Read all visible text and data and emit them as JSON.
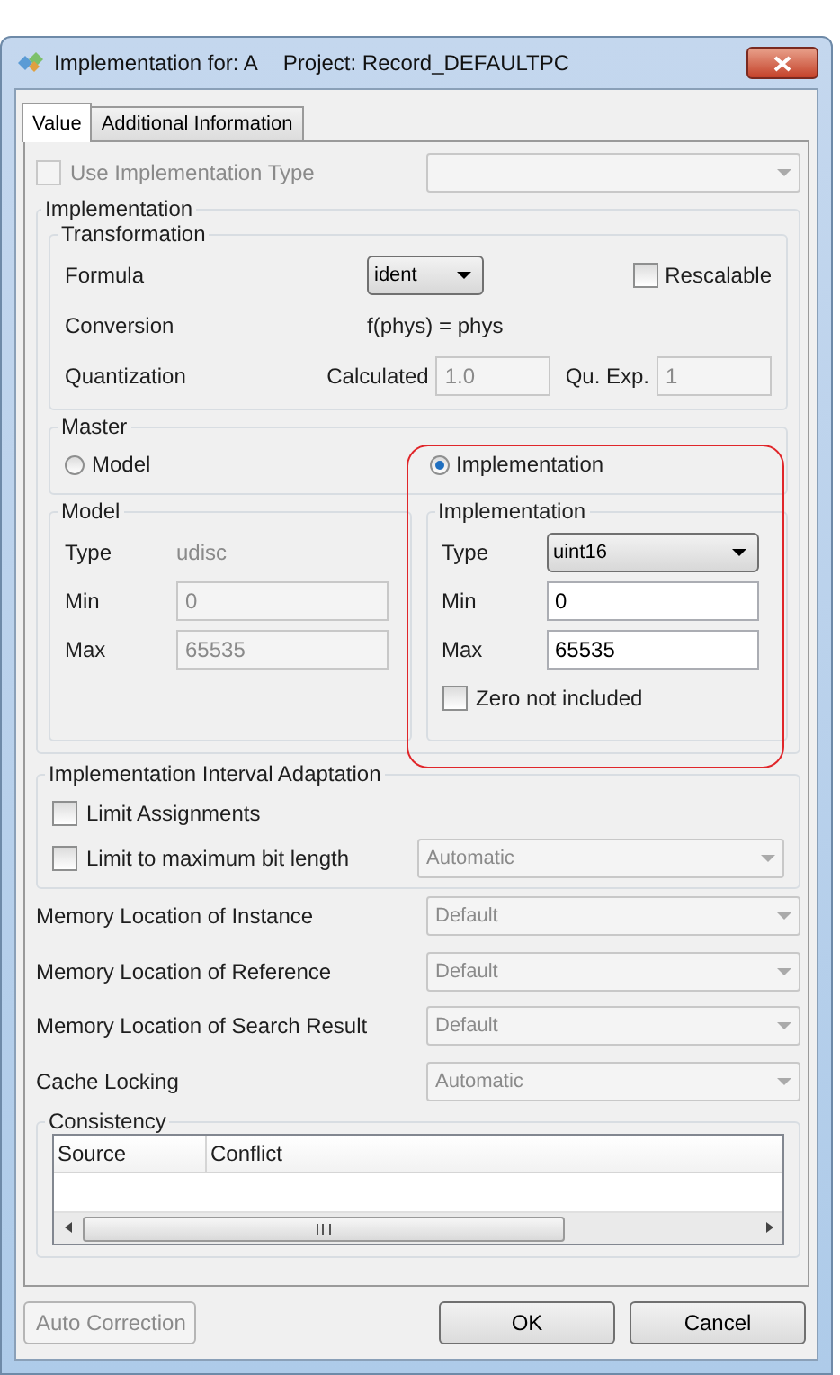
{
  "window": {
    "title": "Implementation for: A",
    "project": "Project: Record_DEFAULTPC"
  },
  "tabs": [
    {
      "label": "Value",
      "selected": true
    },
    {
      "label": "Additional Information",
      "selected": false
    }
  ],
  "use_implementation_type": {
    "label": "Use Implementation Type",
    "checked": false,
    "disabled": true
  },
  "implementation": {
    "title": "Implementation",
    "transformation": {
      "title": "Transformation",
      "formula_label": "Formula",
      "formula_value": "ident",
      "rescalable": {
        "label": "Rescalable",
        "checked": false
      },
      "conversion_label": "Conversion",
      "conversion_value": "f(phys) = phys",
      "quantization_label": "Quantization",
      "calculated_label": "Calculated",
      "calculated_value": "1.0",
      "exp_label": "Qu. Exp.",
      "exp_value": "1"
    },
    "master": {
      "title": "Master",
      "options": [
        {
          "label": "Model",
          "selected": false
        },
        {
          "label": "Implementation",
          "selected": true
        }
      ]
    },
    "model": {
      "title": "Model",
      "type_label": "Type",
      "type_value": "udisc",
      "min_label": "Min",
      "min_value": "0",
      "max_label": "Max",
      "max_value": "65535"
    },
    "impl": {
      "title": "Implementation",
      "type_label": "Type",
      "type_value": "uint16",
      "min_label": "Min",
      "min_value": "0",
      "max_label": "Max",
      "max_value": "65535",
      "zero_not_included": {
        "label": "Zero not included",
        "checked": false
      }
    }
  },
  "interval_adaptation": {
    "title": "Implementation Interval Adaptation",
    "options": [
      {
        "label": "Limit Assignments",
        "checked": false
      },
      {
        "label": "Limit to maximum bit length",
        "checked": false,
        "dropdown": "Automatic"
      }
    ]
  },
  "settings": [
    {
      "label": "Memory Location of Instance",
      "value": "Default",
      "disabled": true
    },
    {
      "label": "Memory Location of Reference",
      "value": "Default",
      "disabled": true
    },
    {
      "label": "Memory Location of Search Result",
      "value": "Default",
      "disabled": true
    },
    {
      "label": "Cache Locking",
      "value": "Automatic",
      "disabled": true
    }
  ],
  "consistency": {
    "title": "Consistency",
    "columns": [
      "Source",
      "Conflict"
    ]
  },
  "buttons": [
    {
      "label": "Auto Correction",
      "disabled": true
    },
    {
      "label": "OK",
      "disabled": false
    },
    {
      "label": "Cancel",
      "disabled": false
    }
  ]
}
